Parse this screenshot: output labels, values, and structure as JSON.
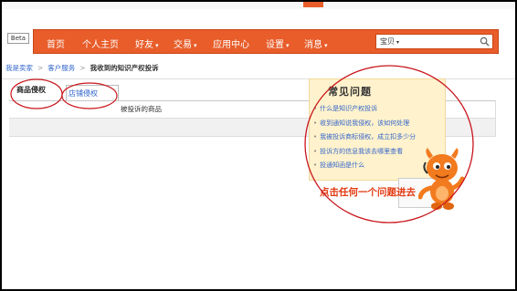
{
  "beta_badge": "Beta",
  "nav": {
    "items": [
      {
        "label": "首页",
        "has_caret": false
      },
      {
        "label": "个人主页",
        "has_caret": false
      },
      {
        "label": "好友",
        "has_caret": true
      },
      {
        "label": "交易",
        "has_caret": true
      },
      {
        "label": "应用中心",
        "has_caret": false
      },
      {
        "label": "设置",
        "has_caret": true
      },
      {
        "label": "消息",
        "has_caret": true
      }
    ],
    "search": {
      "category": "宝贝",
      "value": "",
      "icon": "search-icon"
    },
    "accent_color": "#e85d2a"
  },
  "breadcrumb": {
    "items": [
      "我是卖家",
      "客户服务"
    ],
    "current": "我收到的知识产权投诉"
  },
  "tabs": [
    {
      "label": "商品侵权",
      "active": true
    },
    {
      "label": "店铺侵权",
      "active": false
    }
  ],
  "table": {
    "column_header": "被投诉的商品"
  },
  "faq": {
    "title": "常见问题",
    "items": [
      "什么是知识产权投诉",
      "收到通知说我侵权，该如何处理",
      "我被投诉商标侵权，成立扣多少分",
      "投诉方的信息我该去哪里查看",
      "投通知函是什么"
    ]
  },
  "annotation": {
    "text": "点击任何一个问题进去",
    "color": "#e23b13"
  }
}
